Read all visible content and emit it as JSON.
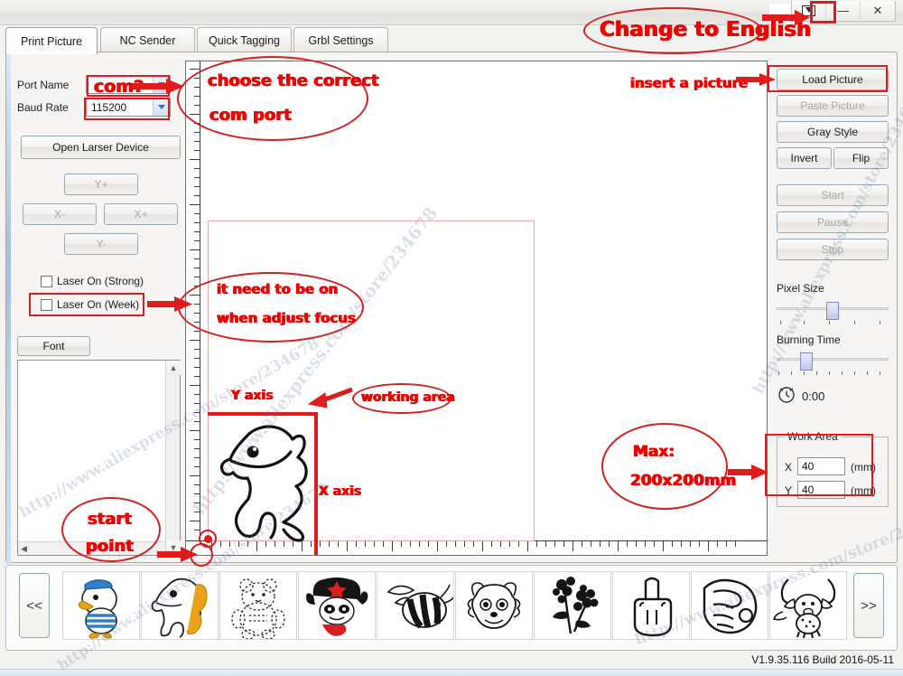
{
  "window": {
    "buttons": [
      {
        "name": "language-toggle",
        "glyph": "lang"
      },
      {
        "name": "minimize",
        "glyph": "—"
      },
      {
        "name": "close",
        "glyph": "✕"
      }
    ]
  },
  "tabs": [
    {
      "label": "Print Picture",
      "active": true
    },
    {
      "label": "NC Sender",
      "active": false
    },
    {
      "label": "Quick Tagging",
      "active": false
    },
    {
      "label": "Grbl Settings",
      "active": false
    }
  ],
  "left_panel": {
    "port_name_label": "Port Name",
    "port_name_value": "",
    "baud_rate_label": "Baud Rate",
    "baud_rate_value": "115200",
    "open_device_button": "Open Larser Device",
    "jog": {
      "y_plus": "Y+",
      "x_minus": "X-",
      "x_plus": "X+",
      "y_minus": "Y-"
    },
    "laser_strong_label": "Laser On (Strong)",
    "laser_strong_checked": false,
    "laser_week_label": "Laser On (Week)",
    "laser_week_checked": false,
    "font_button": "Font",
    "text_area_value": ""
  },
  "right_panel": {
    "load_picture": "Load Picture",
    "paste_picture": "Paste Picture",
    "gray_style": "Gray Style",
    "invert": "Invert",
    "flip": "Flip",
    "start": "Start",
    "pause": "Pause",
    "stop": "Stop",
    "pixel_size_label": "Pixel Size",
    "burning_time_label": "Burning Time",
    "elapsed_time": "0:00",
    "work_area_title": "Work Area",
    "x_label": "X",
    "x_value": "40",
    "x_unit": "(mm)",
    "y_label": "Y",
    "y_value": "40",
    "y_unit": "(mm)"
  },
  "canvas": {
    "y_axis_label": "Y axis",
    "x_axis_label": "X axis"
  },
  "thumbnails": {
    "prev_button": "<<",
    "next_button": ">>",
    "items": [
      {
        "name": "duck"
      },
      {
        "name": "horse"
      },
      {
        "name": "bear"
      },
      {
        "name": "panda-hat"
      },
      {
        "name": "bee"
      },
      {
        "name": "sheep"
      },
      {
        "name": "flower"
      },
      {
        "name": "hand-finger"
      },
      {
        "name": "hand-pointing"
      },
      {
        "name": "bull"
      }
    ]
  },
  "status": {
    "version": "V1.9.35.116 Build 2016-05-11"
  },
  "annotations": {
    "change_to_english": "Change to English",
    "choose_com_port_line1": "choose the correct",
    "choose_com_port_line2": "com port",
    "com_question": "com?",
    "insert_a_picture": "insert a picture",
    "need_on_line1": "it need to be on",
    "need_on_line2": "when adjust focus",
    "working_area": "working area",
    "max_line1": "Max:",
    "max_line2": "200x200mm",
    "start_point_line1": "start",
    "start_point_line2": "point"
  },
  "watermark": {
    "text": "http://www.aliexpress.com/store/234678"
  },
  "colors": {
    "annotation_red": "#f00000",
    "highlight_red": "#e01b1b",
    "work_rect_red": "#e01b1b",
    "pink_frame": "#eda9a9",
    "accent_blue": "#9cc3e8"
  }
}
